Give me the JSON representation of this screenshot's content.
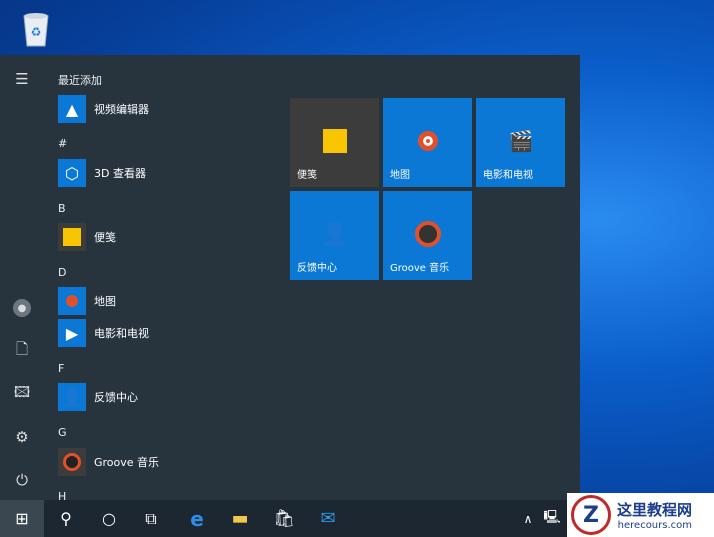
{
  "desktop": {
    "recycle_bin": "recycle-bin-icon"
  },
  "start_menu": {
    "recent_header": "最近添加",
    "items": [
      {
        "label": "视频编辑器",
        "section": null
      },
      {
        "section": "#",
        "label": "3D 查看器"
      },
      {
        "section": "B",
        "label": "便笺"
      },
      {
        "section": "D",
        "label": "地图"
      },
      {
        "section": null,
        "label": "电影和电视"
      },
      {
        "section": "F",
        "label": "反馈中心"
      },
      {
        "section": "G",
        "label": "Groove 音乐"
      }
    ],
    "last_section": "H",
    "tiles": [
      {
        "label": "便笺",
        "color": "#3c3c3c"
      },
      {
        "label": "地图",
        "color": "#0a78d4"
      },
      {
        "label": "电影和电视",
        "color": "#0a78d4"
      },
      {
        "label": "反馈中心",
        "color": "#0a78d4"
      },
      {
        "label": "Groove 音乐",
        "color": "#0a78d4"
      }
    ]
  },
  "watermark": {
    "title": "这里教程网",
    "url": "herecours.com"
  }
}
